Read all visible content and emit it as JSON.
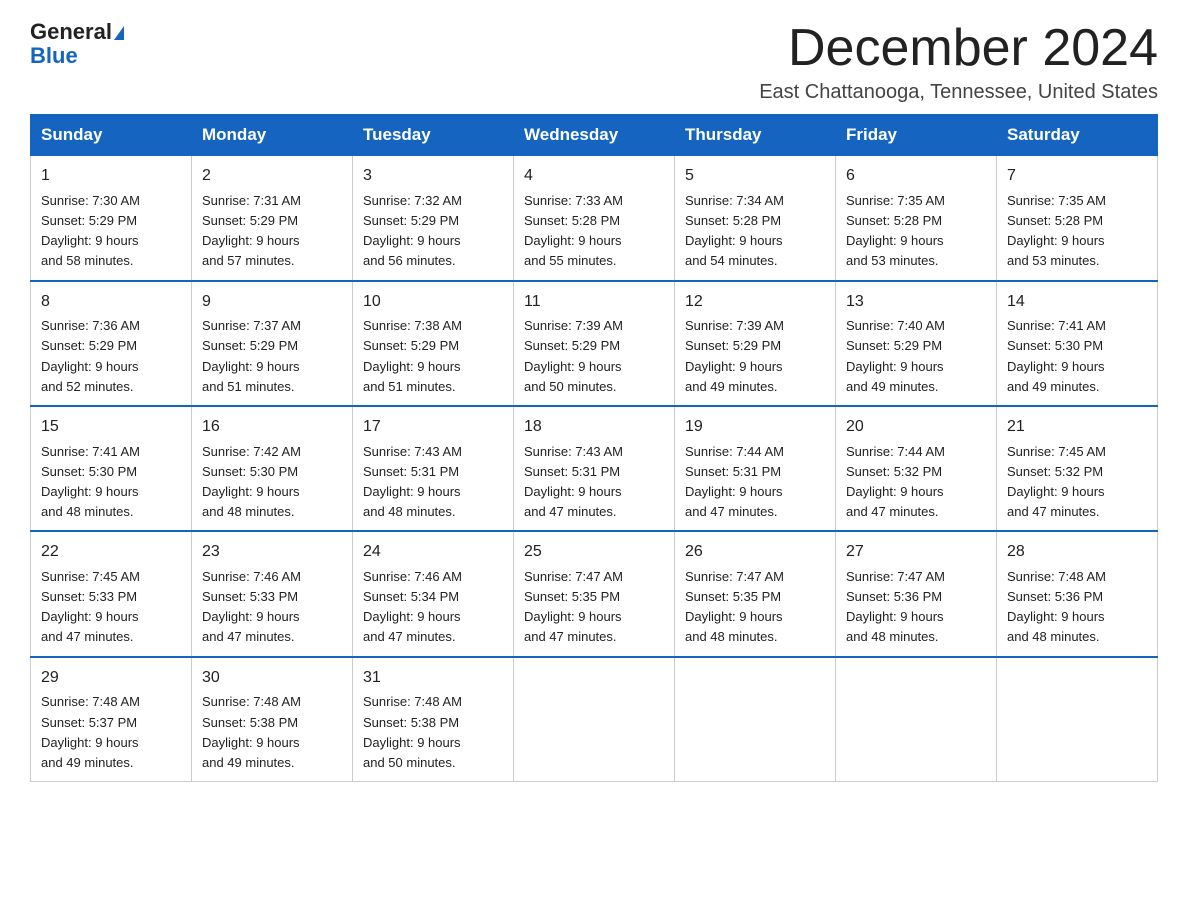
{
  "header": {
    "logo_line1": "General",
    "logo_line2": "Blue",
    "month_title": "December 2024",
    "location": "East Chattanooga, Tennessee, United States"
  },
  "weekdays": [
    "Sunday",
    "Monday",
    "Tuesday",
    "Wednesday",
    "Thursday",
    "Friday",
    "Saturday"
  ],
  "weeks": [
    [
      {
        "day": "1",
        "sunrise": "7:30 AM",
        "sunset": "5:29 PM",
        "daylight": "9 hours and 58 minutes."
      },
      {
        "day": "2",
        "sunrise": "7:31 AM",
        "sunset": "5:29 PM",
        "daylight": "9 hours and 57 minutes."
      },
      {
        "day": "3",
        "sunrise": "7:32 AM",
        "sunset": "5:29 PM",
        "daylight": "9 hours and 56 minutes."
      },
      {
        "day": "4",
        "sunrise": "7:33 AM",
        "sunset": "5:28 PM",
        "daylight": "9 hours and 55 minutes."
      },
      {
        "day": "5",
        "sunrise": "7:34 AM",
        "sunset": "5:28 PM",
        "daylight": "9 hours and 54 minutes."
      },
      {
        "day": "6",
        "sunrise": "7:35 AM",
        "sunset": "5:28 PM",
        "daylight": "9 hours and 53 minutes."
      },
      {
        "day": "7",
        "sunrise": "7:35 AM",
        "sunset": "5:28 PM",
        "daylight": "9 hours and 53 minutes."
      }
    ],
    [
      {
        "day": "8",
        "sunrise": "7:36 AM",
        "sunset": "5:29 PM",
        "daylight": "9 hours and 52 minutes."
      },
      {
        "day": "9",
        "sunrise": "7:37 AM",
        "sunset": "5:29 PM",
        "daylight": "9 hours and 51 minutes."
      },
      {
        "day": "10",
        "sunrise": "7:38 AM",
        "sunset": "5:29 PM",
        "daylight": "9 hours and 51 minutes."
      },
      {
        "day": "11",
        "sunrise": "7:39 AM",
        "sunset": "5:29 PM",
        "daylight": "9 hours and 50 minutes."
      },
      {
        "day": "12",
        "sunrise": "7:39 AM",
        "sunset": "5:29 PM",
        "daylight": "9 hours and 49 minutes."
      },
      {
        "day": "13",
        "sunrise": "7:40 AM",
        "sunset": "5:29 PM",
        "daylight": "9 hours and 49 minutes."
      },
      {
        "day": "14",
        "sunrise": "7:41 AM",
        "sunset": "5:30 PM",
        "daylight": "9 hours and 49 minutes."
      }
    ],
    [
      {
        "day": "15",
        "sunrise": "7:41 AM",
        "sunset": "5:30 PM",
        "daylight": "9 hours and 48 minutes."
      },
      {
        "day": "16",
        "sunrise": "7:42 AM",
        "sunset": "5:30 PM",
        "daylight": "9 hours and 48 minutes."
      },
      {
        "day": "17",
        "sunrise": "7:43 AM",
        "sunset": "5:31 PM",
        "daylight": "9 hours and 48 minutes."
      },
      {
        "day": "18",
        "sunrise": "7:43 AM",
        "sunset": "5:31 PM",
        "daylight": "9 hours and 47 minutes."
      },
      {
        "day": "19",
        "sunrise": "7:44 AM",
        "sunset": "5:31 PM",
        "daylight": "9 hours and 47 minutes."
      },
      {
        "day": "20",
        "sunrise": "7:44 AM",
        "sunset": "5:32 PM",
        "daylight": "9 hours and 47 minutes."
      },
      {
        "day": "21",
        "sunrise": "7:45 AM",
        "sunset": "5:32 PM",
        "daylight": "9 hours and 47 minutes."
      }
    ],
    [
      {
        "day": "22",
        "sunrise": "7:45 AM",
        "sunset": "5:33 PM",
        "daylight": "9 hours and 47 minutes."
      },
      {
        "day": "23",
        "sunrise": "7:46 AM",
        "sunset": "5:33 PM",
        "daylight": "9 hours and 47 minutes."
      },
      {
        "day": "24",
        "sunrise": "7:46 AM",
        "sunset": "5:34 PM",
        "daylight": "9 hours and 47 minutes."
      },
      {
        "day": "25",
        "sunrise": "7:47 AM",
        "sunset": "5:35 PM",
        "daylight": "9 hours and 47 minutes."
      },
      {
        "day": "26",
        "sunrise": "7:47 AM",
        "sunset": "5:35 PM",
        "daylight": "9 hours and 48 minutes."
      },
      {
        "day": "27",
        "sunrise": "7:47 AM",
        "sunset": "5:36 PM",
        "daylight": "9 hours and 48 minutes."
      },
      {
        "day": "28",
        "sunrise": "7:48 AM",
        "sunset": "5:36 PM",
        "daylight": "9 hours and 48 minutes."
      }
    ],
    [
      {
        "day": "29",
        "sunrise": "7:48 AM",
        "sunset": "5:37 PM",
        "daylight": "9 hours and 49 minutes."
      },
      {
        "day": "30",
        "sunrise": "7:48 AM",
        "sunset": "5:38 PM",
        "daylight": "9 hours and 49 minutes."
      },
      {
        "day": "31",
        "sunrise": "7:48 AM",
        "sunset": "5:38 PM",
        "daylight": "9 hours and 50 minutes."
      },
      null,
      null,
      null,
      null
    ]
  ]
}
